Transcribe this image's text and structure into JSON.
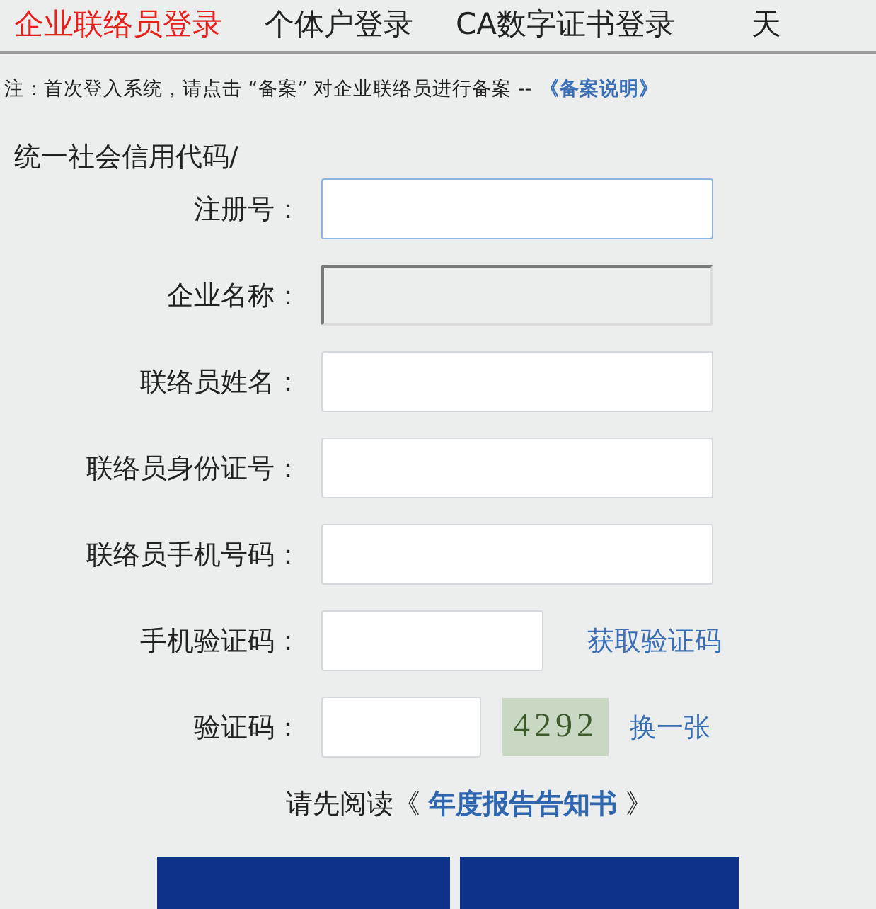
{
  "tabs": [
    {
      "label": "企业联络员登录",
      "selected": true
    },
    {
      "label": "个体户登录",
      "selected": false
    },
    {
      "label": "CA数字证书登录",
      "selected": false
    },
    {
      "label": "天",
      "selected": false
    }
  ],
  "notice": {
    "text": "注：首次登入系统，请点击 “备案” 对企业联络员进行备案 --",
    "link": "《备案说明》"
  },
  "form": {
    "heading": "统一社会信用代码/",
    "fields": [
      {
        "kind": "text",
        "label": "注册号：",
        "disabled": false,
        "focused": true
      },
      {
        "kind": "text",
        "label": "企业名称：",
        "disabled": true,
        "focused": false
      },
      {
        "kind": "text",
        "label": "联络员姓名：",
        "disabled": false,
        "focused": false
      },
      {
        "kind": "text",
        "label": "联络员身份证号：",
        "disabled": false,
        "focused": false
      },
      {
        "kind": "text",
        "label": "联络员手机号码：",
        "disabled": false,
        "focused": false
      },
      {
        "kind": "sms",
        "label": "手机验证码：",
        "disabled": false,
        "focused": false,
        "link": "获取验证码"
      },
      {
        "kind": "captcha",
        "label": "验证码：",
        "disabled": false,
        "focused": false,
        "captcha": "4292",
        "link": "换一张"
      }
    ]
  },
  "read_first": {
    "text": "请先阅读《",
    "link": "年度报告告知书",
    "close": "》"
  },
  "buttons": [
    {
      "kind": "primary"
    },
    {
      "kind": "primary"
    }
  ]
}
